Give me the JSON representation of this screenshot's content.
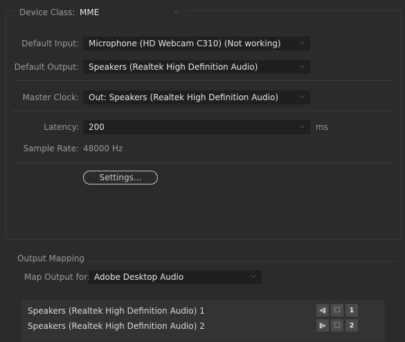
{
  "device_class": {
    "label": "Device Class:",
    "value": "MME"
  },
  "default_input": {
    "label": "Default Input:",
    "value": "Microphone (HD Webcam C310) (Not working)"
  },
  "default_output": {
    "label": "Default Output:",
    "value": "Speakers (Realtek High Definition Audio)"
  },
  "master_clock": {
    "label": "Master Clock:",
    "value": "Out: Speakers (Realtek High Definition Audio)"
  },
  "latency": {
    "label": "Latency:",
    "value": "200",
    "unit": "ms"
  },
  "sample_rate": {
    "label": "Sample Rate:",
    "value": "48000 Hz"
  },
  "settings_button": {
    "label": "Settings..."
  },
  "output_mapping": {
    "title": "Output Mapping",
    "map_for_label": "Map Output for:",
    "map_for_value": "Adobe Desktop Audio",
    "channels": [
      {
        "name": "Speakers (Realtek High Definition Audio) 1",
        "channel": "1"
      },
      {
        "name": "Speakers (Realtek High Definition Audio) 2",
        "channel": "2"
      }
    ]
  },
  "icons": {
    "dropdown": "chevron-down-icon",
    "speaker": "speaker-icon",
    "channel_select": "channel-select-icon"
  },
  "colors": {
    "background": "#2b2b2b",
    "field": "#1f1f1f",
    "text": "#e6e6e6",
    "label": "#9a9a9a"
  }
}
